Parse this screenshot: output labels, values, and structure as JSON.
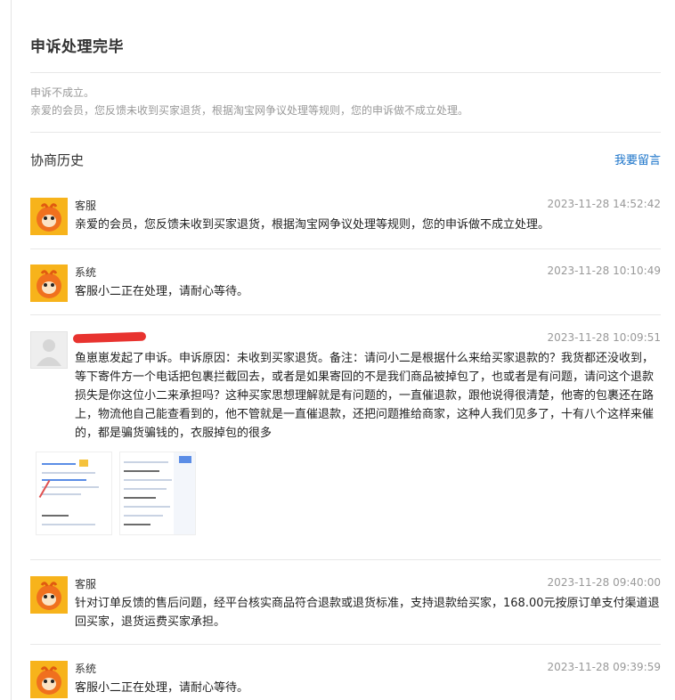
{
  "result": {
    "title": "申诉处理完毕",
    "status": "申诉不成立。",
    "detail": "亲爱的会员，您反馈未收到买家退货，根据淘宝网争议处理等规则，您的申诉做不成立处理。"
  },
  "history": {
    "title": "协商历史",
    "leave_message": "我要留言",
    "entries": [
      {
        "author": "客服",
        "time": "2023-11-28 14:52:42",
        "message": "亲爱的会员，您反馈未收到买家退货，根据淘宝网争议处理等规则，您的申诉做不成立处理。"
      },
      {
        "author": "系统",
        "time": "2023-11-28 10:10:49",
        "message": "客服小二正在处理，请耐心等待。"
      },
      {
        "author": "",
        "time": "2023-11-28 10:09:51",
        "message": "鱼崽崽发起了申诉。申诉原因：未收到买家退货。备注：请问小二是根据什么来给买家退款的？我货都还没收到，等下寄件方一个电话把包裹拦截回去，或者是如果寄回的不是我们商品被掉包了，也或者是有问题，请问这个退款损失是你这位小二来承担吗？这种买家思想理解就是有问题的，一直催退款，跟他说得很清楚，他寄的包裹还在路上，物流他自己能查看到的，他不管就是一直催退款，还把问题推给商家，这种人我们见多了，十有八个这样来催的，都是骗货骗钱的，衣服掉包的很多"
      },
      {
        "author": "客服",
        "time": "2023-11-28 09:40:00",
        "message": "针对订单反馈的售后问题，经平台核实商品符合退款或退货标准，支持退款给买家，168.00元按原订单支付渠道退回买家，退货运费买家承担。"
      },
      {
        "author": "系统",
        "time": "2023-11-28 09:39:59",
        "message": "客服小二正在处理，请耐心等待。"
      }
    ]
  },
  "icons": {
    "service_avatar": "taobao-mascot-icon",
    "user_avatar": "default-user-icon",
    "attachments": [
      "chat-screenshot-thumbnail",
      "order-screenshot-thumbnail"
    ]
  },
  "colors": {
    "link": "#1a73c9",
    "muted": "#999999",
    "avatar_orange": "#f7b31b",
    "redaction": "#e8332f"
  }
}
